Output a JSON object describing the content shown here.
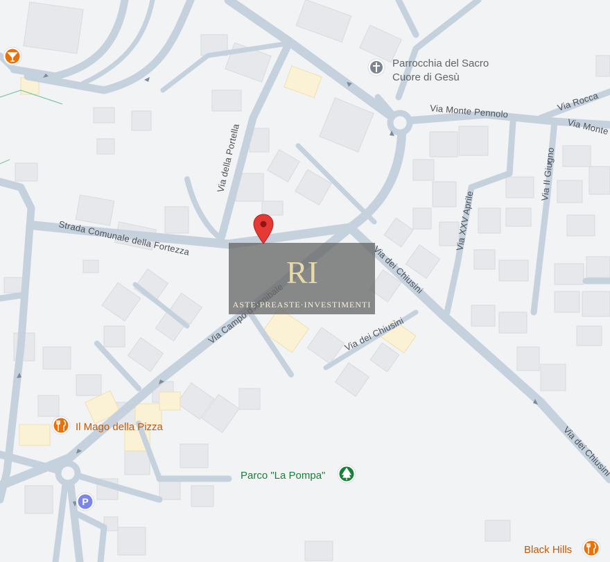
{
  "map": {
    "roads": [
      {
        "name": "Via della Portella"
      },
      {
        "name": "Strada Comunale della Fortezza"
      },
      {
        "name": "Via Campo d'Annibale"
      },
      {
        "name": "Via dei Chiusini (main)"
      },
      {
        "name": "Via dei Chiusini (secondary)"
      },
      {
        "name": "Via dei Chiusini (south-east)"
      },
      {
        "name": "Via Monte Pennolo"
      },
      {
        "name": "Via Monte (east)"
      },
      {
        "name": "Via Rocca"
      },
      {
        "name": "Via XXV Aprile"
      },
      {
        "name": "Via II Giugno"
      }
    ],
    "labels": {
      "portella": "Via della Portella",
      "fortezza": "Strada Comunale della Fortezza",
      "campo": "Via Campo d'Annibale",
      "chiusini_main": "Via dei Chiusini",
      "chiusini_secondary": "Via dei Chiusini",
      "chiusini_se": "Via dei Chiusini",
      "pennolo": "Via Monte Pennolo",
      "monte_east": "Via Monte",
      "rocca": "Via Rocca",
      "xxv_aprile": "Via XXV Aprile",
      "ii_giugno": "Via II Giugno"
    },
    "pois": {
      "church": {
        "name": "Parrocchia del Sacro Cuore di Gesù",
        "line1": "Parrocchia del Sacro",
        "line2": "Cuore di Gesù",
        "icon": "cross-icon",
        "color": "#5f6368"
      },
      "pizza": {
        "name": "Il Mago della Pizza",
        "icon": "restaurant-icon",
        "color": "#e8710a"
      },
      "park": {
        "name": "Parco \"La Pompa\"",
        "icon": "tree-icon",
        "color": "#188038"
      },
      "black_hills": {
        "name": "Black Hills",
        "icon": "restaurant-icon",
        "color": "#e8710a"
      },
      "bar": {
        "icon": "cocktail-icon",
        "color": "#e8710a"
      },
      "parking": {
        "letter": "P",
        "icon": "parking-icon",
        "color": "#7b86e6"
      }
    },
    "marker": {
      "icon": "location-pin-icon",
      "color": "#d93025"
    },
    "watermark": {
      "logo_letters": "RI",
      "text": "ASTE·PREASTE·INVESTIMENTI"
    },
    "colors": {
      "background": "#f1f3f4",
      "road": "#c5d2de",
      "road_stroke": "#b3c2d1",
      "building": "#e6e8eb",
      "building_stroke": "#d6d9dd",
      "highlight_building": "#fbf1d5"
    }
  }
}
